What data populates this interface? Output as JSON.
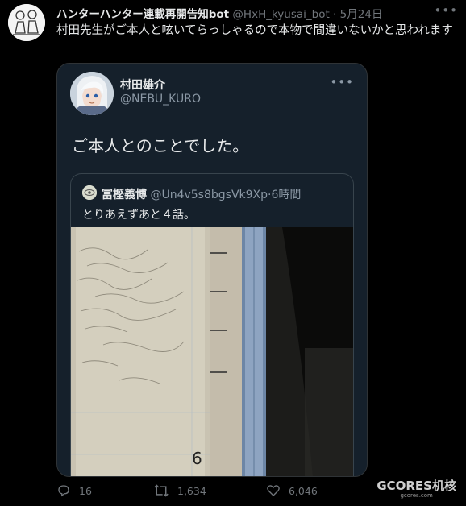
{
  "tweet": {
    "display_name": "ハンターハンター連載再開告知bot",
    "handle": "@HxH_kyusai_bot",
    "separator": "·",
    "date": "5月24日",
    "text": "村田先生がご本人と呟いてらっしゃるので本物で間違いないかと思われます"
  },
  "embedded": {
    "display_name": "村田雄介",
    "handle": "@NEBU_KURO",
    "text": "ご本人とのことでした。",
    "quote": {
      "display_name": "冨樫義博",
      "handle": "@Un4v5s8bgsVk9Xp",
      "separator": "·",
      "time": "6時間",
      "text": "とりあえずあと４話。",
      "photo_page_number": "6"
    }
  },
  "actions": {
    "replies": "16",
    "retweets": "1,634",
    "likes": "6,046"
  },
  "watermark": {
    "brand": "GCORES机核",
    "site": "gcores.com"
  },
  "colors": {
    "background": "#000000",
    "card_background": "#15202b",
    "secondary_text": "#71767b",
    "border": "#38444d"
  }
}
